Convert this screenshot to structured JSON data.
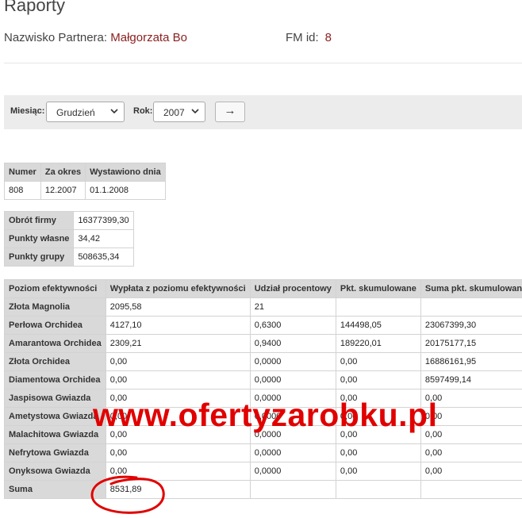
{
  "page": {
    "title": "Raporty"
  },
  "partner": {
    "label": "Nazwisko Partnera:",
    "name": "Małgorzata Bo"
  },
  "fm": {
    "label": "FM id:",
    "value": "8"
  },
  "filter": {
    "month_label": "Miesiąc:",
    "month_value": "Grudzień",
    "year_label": "Rok:",
    "year_value": "2007",
    "go_symbol": "→"
  },
  "invoice": {
    "headers": [
      "Numer",
      "Za okres",
      "Wystawiono dnia"
    ],
    "row": [
      "808",
      "12.2007",
      "01.1.2008"
    ]
  },
  "summary": [
    {
      "label": "Obrót firmy",
      "value": "16377399,30"
    },
    {
      "label": "Punkty własne",
      "value": "34,42"
    },
    {
      "label": "Punkty grupy",
      "value": "508635,34"
    }
  ],
  "levels": {
    "headers": [
      "Poziom efektywności",
      "Wypłata z poziomu efektywności",
      "Udział procentowy",
      "Pkt. skumulowane",
      "Suma pkt. skumulowanych"
    ],
    "rows": [
      [
        "Złota Magnolia",
        "2095,58",
        "21",
        "",
        ""
      ],
      [
        "Perłowa Orchidea",
        "4127,10",
        "0,6300",
        "144498,05",
        "23067399,30"
      ],
      [
        "Amarantowa Orchidea",
        "2309,21",
        "0,9400",
        "189220,01",
        "20175177,15"
      ],
      [
        "Złota Orchidea",
        "0,00",
        "0,0000",
        "0,00",
        "16886161,95"
      ],
      [
        "Diamentowa Orchidea",
        "0,00",
        "0,0000",
        "0,00",
        "8597499,14"
      ],
      [
        "Jaspisowa Gwiazda",
        "0,00",
        "0,0000",
        "0,00",
        "0,00"
      ],
      [
        "Ametystowa Gwiazda",
        "0,00",
        "0,0000",
        "0,00",
        "0,00"
      ],
      [
        "Malachitowa Gwiazda",
        "0,00",
        "0,0000",
        "0,00",
        "0,00"
      ],
      [
        "Nefrytowa Gwiazda",
        "0,00",
        "0,0000",
        "0,00",
        "0,00"
      ],
      [
        "Onyksowa Gwiazda",
        "0,00",
        "0,0000",
        "0,00",
        "0,00"
      ],
      [
        "Suma",
        "8531,89",
        "",
        "",
        ""
      ]
    ]
  },
  "watermark": {
    "text": "www.ofertyzarobku.pl",
    "color": "#e10000"
  },
  "colors": {
    "header_bg": "#d9d9d9",
    "accent_name": "#8b1e1e",
    "filter_bg": "#ececec"
  }
}
